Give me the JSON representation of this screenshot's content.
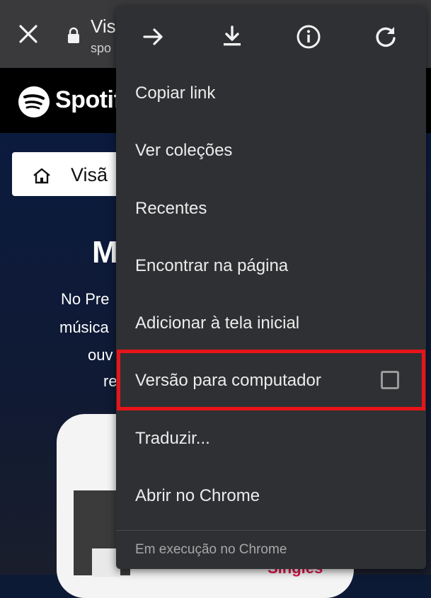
{
  "browser": {
    "page_title": "Vis",
    "host": "spo"
  },
  "site": {
    "brand": "Spotify",
    "home_label": "Visã",
    "heading": "M",
    "lines": [
      "No Pre",
      "música",
      "ouv",
      "re"
    ],
    "phone_badge": "Singles"
  },
  "menu": {
    "icons": [
      "forward-icon",
      "download-icon",
      "info-icon",
      "refresh-icon"
    ],
    "items": [
      {
        "label": "Copiar link"
      },
      {
        "label": "Ver coleções"
      },
      {
        "label": "Recentes"
      },
      {
        "label": "Encontrar na página"
      },
      {
        "label": "Adicionar à tela inicial"
      },
      {
        "label": "Versão para computador",
        "checkbox": true,
        "checked": false,
        "highlighted": true
      },
      {
        "label": "Traduzir..."
      },
      {
        "label": "Abrir no Chrome"
      }
    ],
    "footer": "Em execução no Chrome"
  },
  "colors": {
    "menu_bg": "#2f3033",
    "highlight": "#e8141a",
    "topbar": "#3a3a3c"
  }
}
